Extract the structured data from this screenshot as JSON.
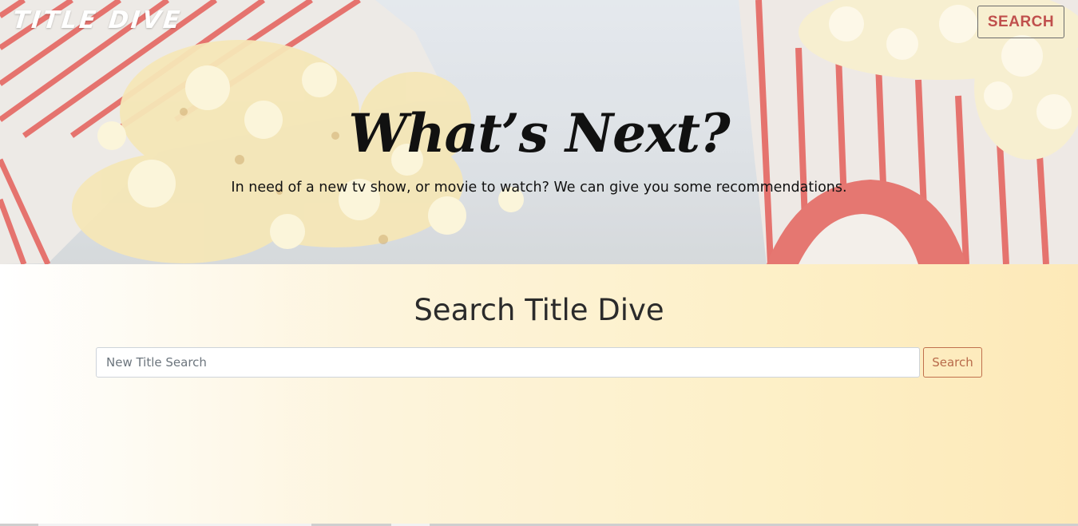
{
  "app": {
    "logo": "TITLE DIVE",
    "nav_search_label": "SEARCH"
  },
  "hero": {
    "title": "What’s Next?",
    "subtitle": "In need of a new tv show, or movie to watch? We can give you some recommendations."
  },
  "search": {
    "heading": "Search Title Dive",
    "input_placeholder": "New Title Search",
    "input_value": "",
    "button_label": "Search"
  },
  "colors": {
    "accent": "#c0504d",
    "button_text": "#b86a4a",
    "gradient_end": "#fde9b8"
  }
}
